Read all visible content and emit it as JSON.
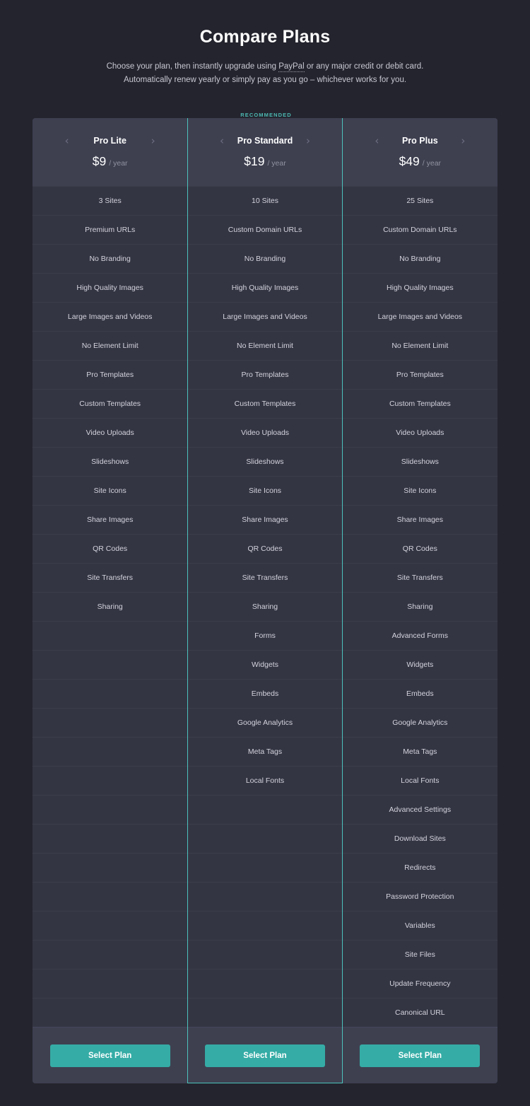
{
  "header": {
    "title": "Compare Plans",
    "subtitle_line1_before": "Choose your plan, then instantly upgrade using ",
    "subtitle_paypal": "PayPal",
    "subtitle_line1_after": " or any major credit or debit card.",
    "subtitle_line2": "Automatically renew yearly or simply pay as you go – whichever works for you."
  },
  "recommended_label": "RECOMMENDED",
  "colors": {
    "page_background": "#24242e",
    "card_background": "#343543",
    "header_band": "#3e4050",
    "accent_teal": "#4cc3bc",
    "button_teal": "#35aca6",
    "row_divider": "#3c3d4b"
  },
  "nav": {
    "prev_icon": "‹",
    "next_icon": "›"
  },
  "plans": [
    {
      "name": "Pro Lite",
      "price": "$9",
      "period": "/ year",
      "recommended": false,
      "cta": "Select Plan"
    },
    {
      "name": "Pro Standard",
      "price": "$19",
      "period": "/ year",
      "recommended": true,
      "cta": "Select Plan"
    },
    {
      "name": "Pro Plus",
      "price": "$49",
      "period": "/ year",
      "recommended": false,
      "cta": "Select Plan"
    }
  ],
  "feature_rows": [
    [
      "3 Sites",
      "10 Sites",
      "25 Sites"
    ],
    [
      "Premium URLs",
      "Custom Domain URLs",
      "Custom Domain URLs"
    ],
    [
      "No Branding",
      "No Branding",
      "No Branding"
    ],
    [
      "High Quality Images",
      "High Quality Images",
      "High Quality Images"
    ],
    [
      "Large Images and Videos",
      "Large Images and Videos",
      "Large Images and Videos"
    ],
    [
      "No Element Limit",
      "No Element Limit",
      "No Element Limit"
    ],
    [
      "Pro Templates",
      "Pro Templates",
      "Pro Templates"
    ],
    [
      "Custom Templates",
      "Custom Templates",
      "Custom Templates"
    ],
    [
      "Video Uploads",
      "Video Uploads",
      "Video Uploads"
    ],
    [
      "Slideshows",
      "Slideshows",
      "Slideshows"
    ],
    [
      "Site Icons",
      "Site Icons",
      "Site Icons"
    ],
    [
      "Share Images",
      "Share Images",
      "Share Images"
    ],
    [
      "QR Codes",
      "QR Codes",
      "QR Codes"
    ],
    [
      "Site Transfers",
      "Site Transfers",
      "Site Transfers"
    ],
    [
      "Sharing",
      "Sharing",
      "Sharing"
    ],
    [
      "",
      "Forms",
      "Advanced Forms"
    ],
    [
      "",
      "Widgets",
      "Widgets"
    ],
    [
      "",
      "Embeds",
      "Embeds"
    ],
    [
      "",
      "Google Analytics",
      "Google Analytics"
    ],
    [
      "",
      "Meta Tags",
      "Meta Tags"
    ],
    [
      "",
      "Local Fonts",
      "Local Fonts"
    ],
    [
      "",
      "",
      "Advanced Settings"
    ],
    [
      "",
      "",
      "Download Sites"
    ],
    [
      "",
      "",
      "Redirects"
    ],
    [
      "",
      "",
      "Password Protection"
    ],
    [
      "",
      "",
      "Variables"
    ],
    [
      "",
      "",
      "Site Files"
    ],
    [
      "",
      "",
      "Update Frequency"
    ],
    [
      "",
      "",
      "Canonical URL"
    ]
  ]
}
